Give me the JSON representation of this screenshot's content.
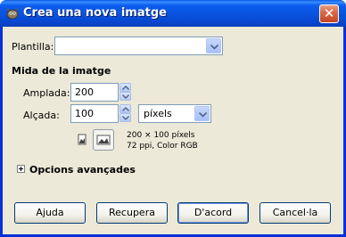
{
  "window": {
    "title": "Crea una nova imatge",
    "close_glyph": "✕"
  },
  "template": {
    "label": "Plantilla:",
    "value": ""
  },
  "image_size": {
    "heading": "Mida de la imatge",
    "width_label": "Amplada:",
    "width_value": "200",
    "height_label": "Alçada:",
    "height_value": "100",
    "unit_value": "píxels",
    "info_line1": "200 × 100 píxels",
    "info_line2": "72 ppi, Color RGB",
    "orientation": "landscape"
  },
  "advanced": {
    "label": "Opcions avançades",
    "expander_glyph": "+"
  },
  "buttons": {
    "help": "Ajuda",
    "reset": "Recupera",
    "ok": "D'acord",
    "cancel": "Cancel·la"
  },
  "colors": {
    "titlebar": "#0a52dc",
    "dialog_bg": "#ece9d8",
    "field_border": "#7f9db9"
  }
}
